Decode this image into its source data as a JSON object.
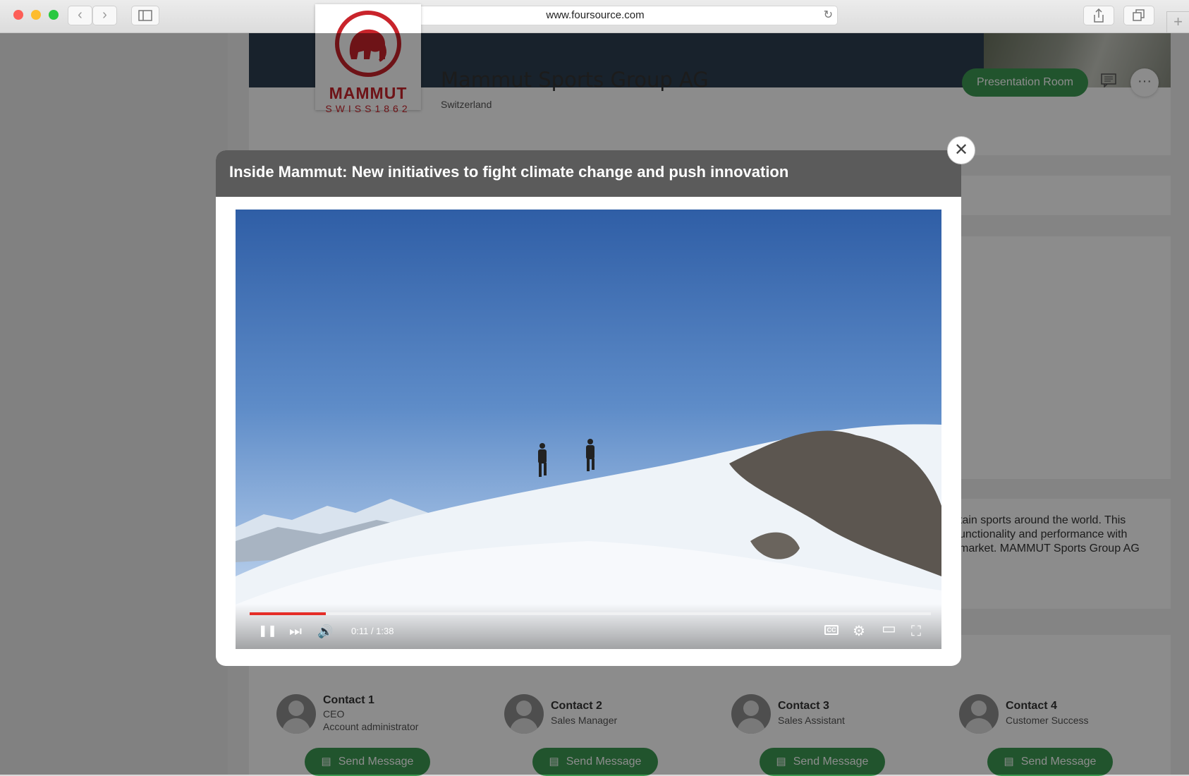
{
  "browser": {
    "url": "www.foursource.com",
    "back_icon": "‹",
    "forward_icon": "›",
    "reload_icon": "↻",
    "new_tab_icon": "+"
  },
  "company": {
    "logo_word": "MAMMUT",
    "logo_sub": "SWISS1862",
    "name": "Mammut Sports Group AG",
    "country": "Switzerland",
    "presentation_button": "Presentation Room",
    "more_icon": "···",
    "about_partial": "tain sports around the world. This unctionality and performance with market. MAMMUT Sports Group AG"
  },
  "modal": {
    "title": "Inside Mammut: New initiatives to fight climate change and push innovation",
    "close_icon": "✕"
  },
  "video": {
    "time_current": "0:11",
    "time_total": "1:38",
    "time_display": "0:11 / 1:38",
    "progress_fraction": 0.112,
    "cc_label": "CC",
    "pause_icon": "❚❚",
    "next_icon": "⏭",
    "volume_icon": "🔊",
    "settings_icon": "⚙",
    "theater_icon": "▭",
    "fullscreen_icon": "⛶",
    "accent_color": "#e52d27"
  },
  "contacts": [
    {
      "name": "Contact 1",
      "role": "CEO",
      "role2": "Account administrator",
      "button": "Send Message"
    },
    {
      "name": "Contact 2",
      "role": "Sales Manager",
      "role2": "",
      "button": "Send Message"
    },
    {
      "name": "Contact 3",
      "role": "Sales Assistant",
      "role2": "",
      "button": "Send Message"
    },
    {
      "name": "Contact 4",
      "role": "Customer Success",
      "role2": "",
      "button": "Send Message"
    }
  ],
  "colors": {
    "brand_green": "#3d9a52",
    "brand_red": "#c9242b",
    "modal_header": "#5b5b5b"
  }
}
